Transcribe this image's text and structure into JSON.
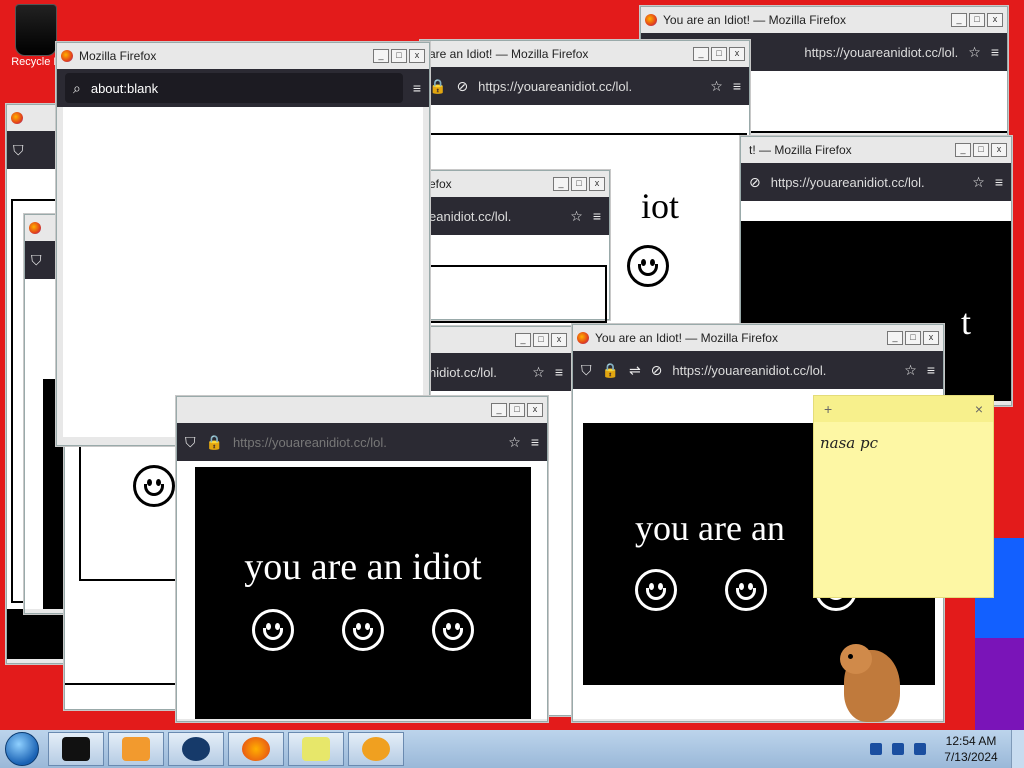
{
  "desktop": {
    "recycle_bin_label": "Recycle B"
  },
  "windows": {
    "front_blank": {
      "title": "Mozilla Firefox",
      "url": "about:blank"
    },
    "top_right": {
      "title": "You are an Idiot! — Mozilla Firefox",
      "url": "https://youareanidiot.cc/lol."
    },
    "top_center": {
      "title": "are an Idiot! — Mozilla Firefox",
      "url": "https://youareanidiot.cc/lol."
    },
    "right_mid": {
      "title": "t! — Mozilla Firefox",
      "url": "https://youareanidiot.cc/lol."
    },
    "center_small": {
      "title": "efox",
      "url": "eanidiot.cc/lol."
    },
    "lower_mid": {
      "url": "nidiot.cc/lol."
    },
    "bottom_left": {
      "url": "https://youareanidiot.cc/lol."
    },
    "bottom_right": {
      "title": "You are an Idiot! — Mozilla Firefox",
      "url": "https://youareanidiot.cc/lol."
    },
    "tab_titles": [
      "You are an Idiot!",
      "You are an Idiot!"
    ]
  },
  "page": {
    "idiot_text": "you are an idiot",
    "idiot_text_partial": "you are an",
    "idiot_fragment": "iot",
    "idiot_fragment_2": "t"
  },
  "sticky_note": {
    "text": "nasa pc",
    "add_label": "+",
    "close_label": "×"
  },
  "taskbar": {
    "time": "12:54 AM",
    "date": "7/13/2024",
    "buttons": [
      "cmd-icon",
      "media-player-icon",
      "globe-icon",
      "firefox-icon",
      "sticky-notes-icon",
      "search-icon"
    ]
  },
  "colors": {
    "desktop": "#e31b1b",
    "firefox_toolbar": "#2b2a33"
  }
}
